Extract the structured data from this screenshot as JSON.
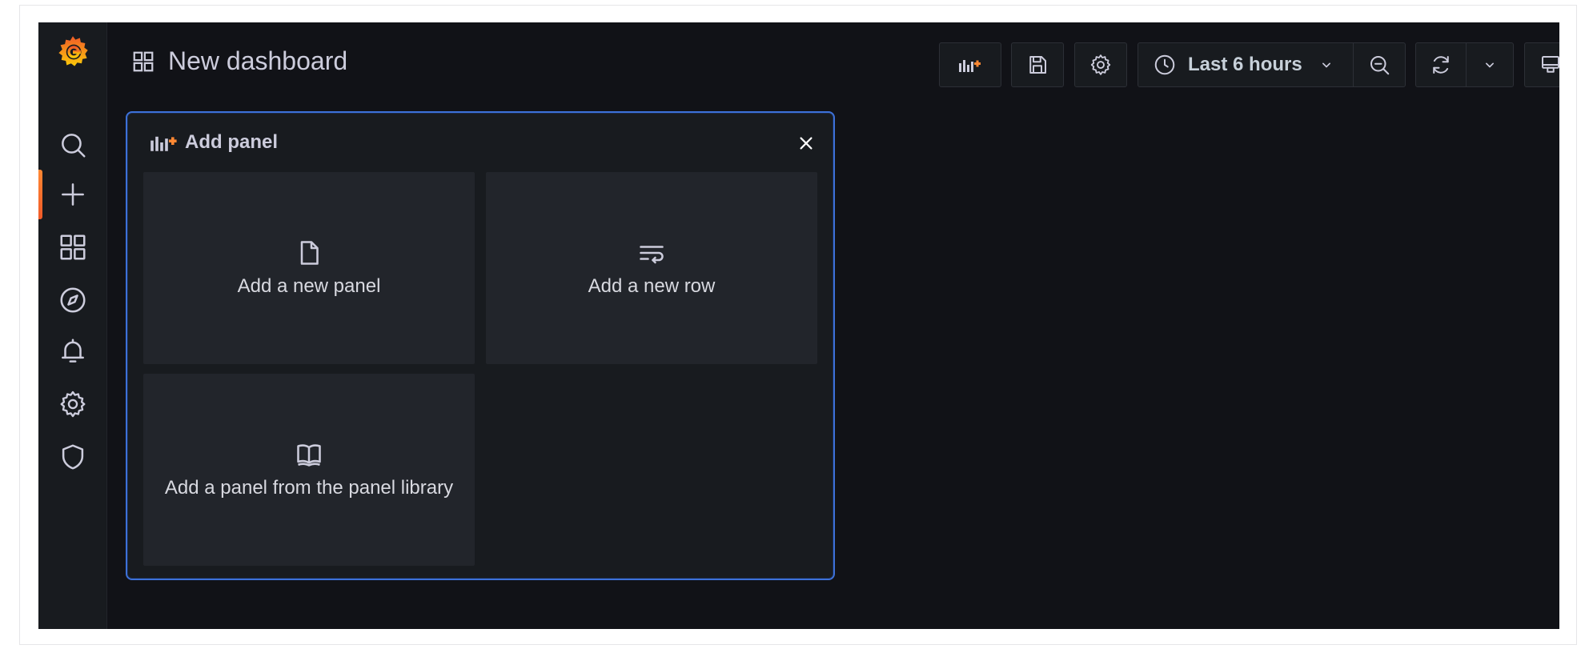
{
  "dashboard": {
    "title": "New dashboard"
  },
  "toolbar": {
    "time_range_label": "Last 6 hours"
  },
  "sidebar": {
    "items": [
      {
        "name": "search",
        "icon": "search-icon",
        "active": false
      },
      {
        "name": "create",
        "icon": "plus-icon",
        "active": true
      },
      {
        "name": "dashboards",
        "icon": "apps-grid-icon",
        "active": false
      },
      {
        "name": "explore",
        "icon": "compass-icon",
        "active": false
      },
      {
        "name": "alerting",
        "icon": "bell-icon",
        "active": false
      },
      {
        "name": "configuration",
        "icon": "gear-icon",
        "active": false
      },
      {
        "name": "server-admin",
        "icon": "shield-icon",
        "active": false
      }
    ]
  },
  "add_panel": {
    "title": "Add panel",
    "options": [
      {
        "label": "Add a new panel",
        "icon": "file-icon"
      },
      {
        "label": "Add a new row",
        "icon": "row-wrap-icon"
      },
      {
        "label": "Add a panel from the panel library",
        "icon": "book-icon"
      }
    ]
  },
  "colors": {
    "background": "#111217",
    "sidebar": "#181b1f",
    "accent_orange": "#ff8833",
    "panel_border": "#3d71d9",
    "card": "#22252b",
    "text": "#ccccdc"
  }
}
